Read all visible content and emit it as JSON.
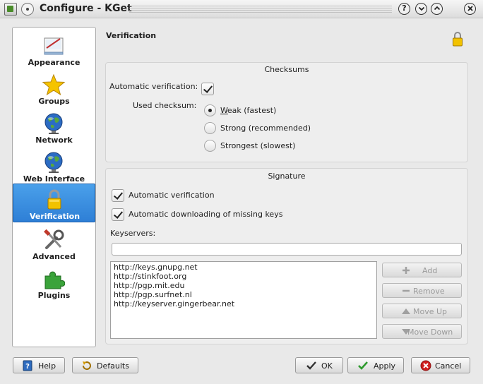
{
  "window": {
    "title": "Configure - KGet"
  },
  "sidebar": {
    "items": [
      {
        "label": "Appearance",
        "icon": "appearance-icon"
      },
      {
        "label": "Groups",
        "icon": "star-icon"
      },
      {
        "label": "Network",
        "icon": "globe-icon"
      },
      {
        "label": "Web Interface",
        "icon": "globe-icon"
      },
      {
        "label": "Verification",
        "icon": "lock-icon",
        "active": true
      },
      {
        "label": "Advanced",
        "icon": "tools-icon"
      },
      {
        "label": "Plugins",
        "icon": "puzzle-icon"
      }
    ]
  },
  "page": {
    "title": "Verification"
  },
  "checksums": {
    "title": "Checksums",
    "auto_label": "Automatic verification:",
    "auto_checked": true,
    "used_label": "Used checksum:",
    "options": [
      {
        "label": "Weak (fastest)",
        "selected": true
      },
      {
        "label": "Strong (recommended)",
        "selected": false
      },
      {
        "label": "Strongest (slowest)",
        "selected": false
      }
    ]
  },
  "signature": {
    "title": "Signature",
    "auto_verify_label": "Automatic verification",
    "auto_verify_checked": true,
    "auto_download_label": "Automatic downloading of missing keys",
    "auto_download_checked": true,
    "keyservers_label": "Keyservers:",
    "keyserver_input_value": "",
    "servers": [
      "http://keys.gnupg.net",
      "http://stinkfoot.org",
      "http://pgp.mit.edu",
      "http://pgp.surfnet.nl",
      "http://keyserver.gingerbear.net"
    ],
    "buttons": {
      "add": "Add",
      "remove": "Remove",
      "move_up": "Move Up",
      "move_down": "Move Down"
    }
  },
  "footer": {
    "help": "Help",
    "defaults": "Defaults",
    "ok": "OK",
    "apply": "Apply",
    "cancel": "Cancel"
  },
  "colors": {
    "selection": "#3a8be0",
    "lock_gold": "#e8b400",
    "apply_check": "#2e9a2e",
    "cancel_red": "#d02020"
  }
}
